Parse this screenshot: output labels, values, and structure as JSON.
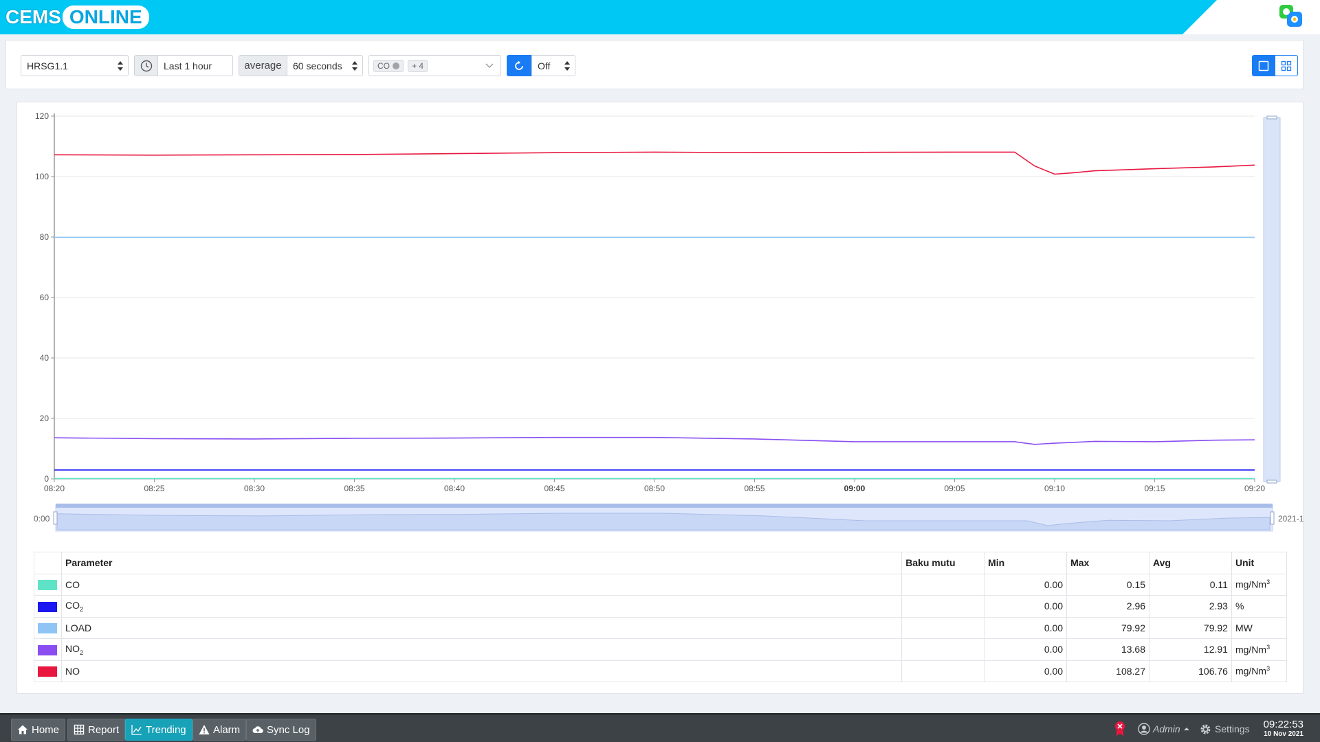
{
  "header": {
    "logo_part1": "CEMS",
    "logo_part2": "ONLINE",
    "brand_color": "#00c8f5"
  },
  "toolbar": {
    "unit_select": "HRSG1.1",
    "time_range": "Last 1 hour",
    "agg_label": "average",
    "interval_select": "60 seconds",
    "param_tag": "CO",
    "param_more": "+ 4",
    "refresh_select": "Off"
  },
  "chart_data": {
    "type": "line",
    "ylim": [
      0,
      120
    ],
    "yticks": [
      "0",
      "20",
      "40",
      "60",
      "80",
      "100",
      "120"
    ],
    "xticks": [
      "08:20",
      "08:25",
      "08:30",
      "08:35",
      "08:40",
      "08:45",
      "08:50",
      "08:55",
      "09:00",
      "09:05",
      "09:10",
      "09:15",
      "09:20"
    ],
    "x_minutes": [
      0,
      5,
      10,
      15,
      20,
      25,
      30,
      35,
      40,
      45,
      48,
      49,
      50,
      51,
      52,
      55,
      58,
      60
    ],
    "series": [
      {
        "color": "#e8173f",
        "values": [
          107.2,
          107.1,
          107.2,
          107.3,
          107.6,
          107.9,
          108.1,
          107.9,
          108.0,
          108.1,
          108.1,
          103.5,
          100.8,
          101.3,
          101.9,
          102.6,
          103.2,
          103.8
        ]
      },
      {
        "color": "#8ec5f5",
        "values": [
          79.92,
          79.92,
          79.92,
          79.92,
          79.92,
          79.92,
          79.92,
          79.92,
          79.92,
          79.92,
          79.92,
          79.92,
          79.92,
          79.92,
          79.92,
          79.92,
          79.92,
          79.92
        ]
      },
      {
        "color": "#8a4df2",
        "values": [
          13.6,
          13.3,
          13.2,
          13.4,
          13.5,
          13.7,
          13.7,
          13.2,
          12.3,
          12.3,
          12.3,
          11.4,
          11.8,
          12.1,
          12.4,
          12.3,
          12.8,
          12.9
        ]
      },
      {
        "color": "#1a17f0",
        "values": [
          2.93,
          2.93,
          2.93,
          2.93,
          2.93,
          2.93,
          2.93,
          2.93,
          2.93,
          2.93,
          2.93,
          2.93,
          2.93,
          2.93,
          2.93,
          2.93,
          2.93,
          2.93
        ]
      },
      {
        "color": "#5fe3c6",
        "values": [
          0.11,
          0.11,
          0.11,
          0.11,
          0.11,
          0.11,
          0.11,
          0.11,
          0.11,
          0.11,
          0.11,
          0.11,
          0.11,
          0.11,
          0.11,
          0.11,
          0.11,
          0.11
        ]
      }
    ],
    "navigator": {
      "left_label": "0:00",
      "right_label": "2021-1"
    }
  },
  "table": {
    "headers": [
      "Parameter",
      "Baku mutu",
      "Min",
      "Max",
      "Avg",
      "Unit"
    ],
    "rows": [
      {
        "color": "#5fe3c6",
        "param": "CO",
        "sub": "",
        "baku": "",
        "min": "0.00",
        "max": "0.15",
        "avg": "0.11",
        "unit": "mg/Nm",
        "unit_sup": "3"
      },
      {
        "color": "#1a17f0",
        "param": "CO",
        "sub": "2",
        "baku": "",
        "min": "0.00",
        "max": "2.96",
        "avg": "2.93",
        "unit": "%",
        "unit_sup": ""
      },
      {
        "color": "#8ec5f5",
        "param": "LOAD",
        "sub": "",
        "baku": "",
        "min": "0.00",
        "max": "79.92",
        "avg": "79.92",
        "unit": "MW",
        "unit_sup": ""
      },
      {
        "color": "#8a4df2",
        "param": "NO",
        "sub": "2",
        "baku": "",
        "min": "0.00",
        "max": "13.68",
        "avg": "12.91",
        "unit": "mg/Nm",
        "unit_sup": "3"
      },
      {
        "color": "#e8173f",
        "param": "NO",
        "sub": "",
        "baku": "",
        "min": "0.00",
        "max": "108.27",
        "avg": "106.76",
        "unit": "mg/Nm",
        "unit_sup": "3"
      }
    ]
  },
  "footer": {
    "home": "Home",
    "report": "Report",
    "trending": "Trending",
    "alarm": "Alarm",
    "sync_log": "Sync Log",
    "user": "Admin",
    "settings": "Settings",
    "time": "09:22:53",
    "date": "10 Nov 2021"
  }
}
